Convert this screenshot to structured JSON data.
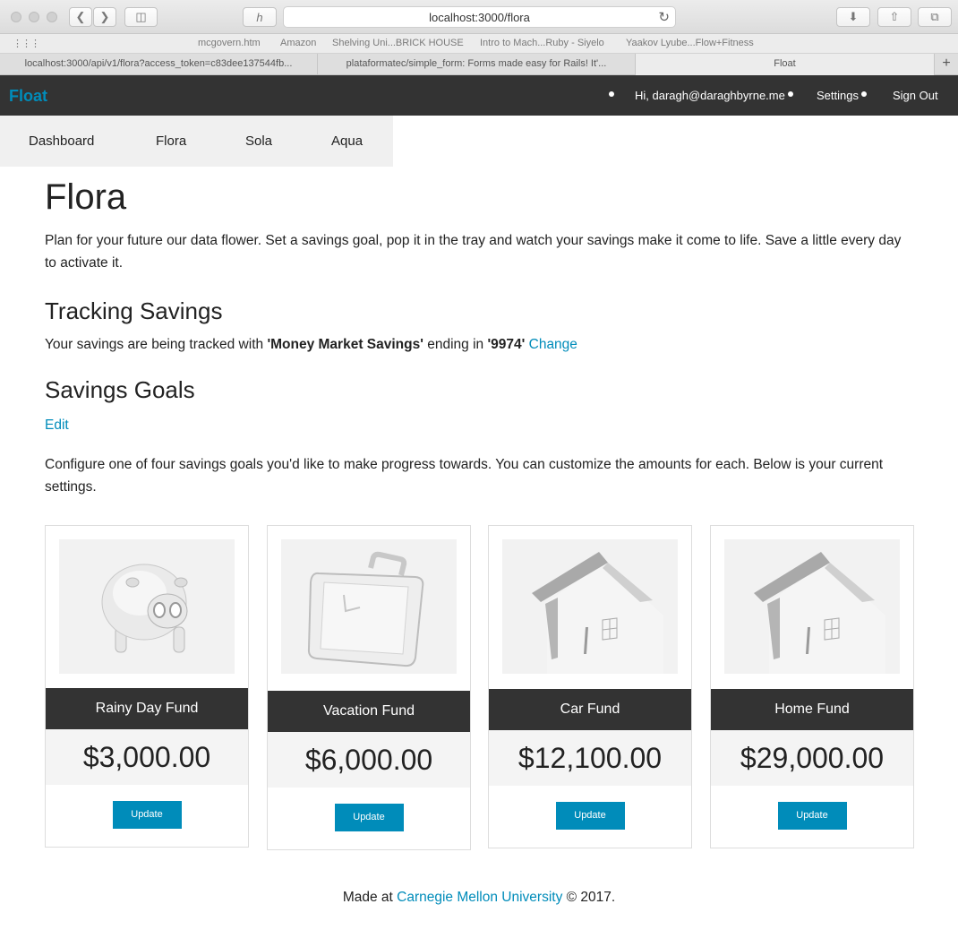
{
  "browser": {
    "url": "localhost:3000/flora",
    "favorites": [
      "mcgovern.htm",
      "Amazon",
      "Shelving Uni...BRICK HOUSE",
      "Intro to Mach...Ruby - Siyelo",
      "Yaakov Lyube...Flow+Fitness"
    ],
    "tabs": [
      "localhost:3000/api/v1/flora?access_token=c83dee137544fb...",
      "plataformatec/simple_form: Forms made easy for Rails! It'...",
      "Float"
    ]
  },
  "nav": {
    "brand": "Float",
    "greeting": "Hi, daragh@daraghbyrne.me",
    "settings": "Settings",
    "signout": "Sign Out"
  },
  "subnav": {
    "items": [
      "Dashboard",
      "Flora",
      "Sola",
      "Aqua"
    ]
  },
  "page": {
    "title": "Flora",
    "intro": "Plan for your future our data flower. Set a savings goal, pop it in the tray and watch your savings make it come to life. Save a little every day to activate it.",
    "tracking_heading": "Tracking Savings",
    "tracking_prefix": "Your savings are being tracked with ",
    "account_name": "'Money Market Savings'",
    "tracking_mid": " ending in ",
    "account_last4": "'9974'",
    "change_link": "Change",
    "goals_heading": "Savings Goals",
    "edit_link": "Edit",
    "config_text": "Configure one of four savings goals you'd like to make progress towards. You can customize the amounts for each. Below is your current settings."
  },
  "cards": [
    {
      "title": "Rainy Day Fund",
      "amount": "$3,000.00",
      "button": "Update",
      "icon": "piggy-bank-icon"
    },
    {
      "title": "Vacation Fund",
      "amount": "$6,000.00",
      "button": "Update",
      "icon": "suitcase-icon"
    },
    {
      "title": "Car Fund",
      "amount": "$12,100.00",
      "button": "Update",
      "icon": "house-icon"
    },
    {
      "title": "Home Fund",
      "amount": "$29,000.00",
      "button": "Update",
      "icon": "house-icon"
    }
  ],
  "footer": {
    "prefix": "Made at ",
    "link": "Carnegie Mellon University",
    "suffix": " © 2017."
  }
}
